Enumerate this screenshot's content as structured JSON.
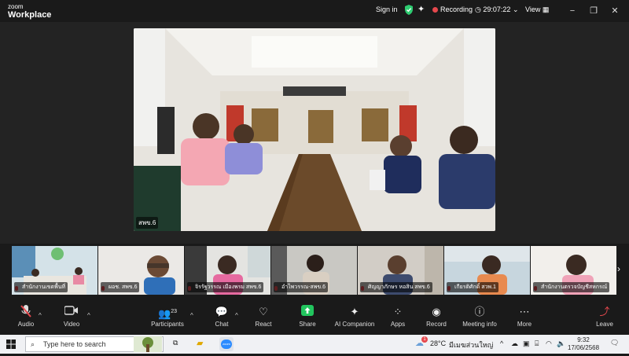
{
  "app": {
    "logo_line1": "zoom",
    "logo_line2": "Workplace"
  },
  "titlebar": {
    "sign_in": "Sign in",
    "recording_label": "Recording",
    "timer": "29:07:22",
    "view_label": "View",
    "colors": {
      "shield": "#2ecc71",
      "recording_dot": "#e5484d"
    }
  },
  "main_video": {
    "name": "สพข.6"
  },
  "participants": [
    {
      "name": "สำนักงานเขตพื้นที่"
    },
    {
      "name": "ผอช. สพข.6"
    },
    {
      "name": "จิรรัฐวรรณ เมืองพรม สพข.6"
    },
    {
      "name": "อำไพวรรณ-สพข.6"
    },
    {
      "name": "ศิญญาภักษร หอสิน สพข.6"
    },
    {
      "name": "เกียรติศักดิ์ สวพ.1"
    },
    {
      "name": "สำนักงานตรวจบัญชีสหกรณ์"
    }
  ],
  "toolbar": {
    "audio": "Audio",
    "video": "Video",
    "participants": "Participants",
    "participants_count": "23",
    "chat": "Chat",
    "react": "React",
    "share": "Share",
    "ai_companion": "AI Companion",
    "apps": "Apps",
    "record": "Record",
    "meeting_info": "Meeting info",
    "more": "More",
    "leave": "Leave",
    "colors": {
      "share": "#22c55e",
      "leave": "#e5484d",
      "mic_muted": "#e5484d"
    }
  },
  "taskbar": {
    "search_placeholder": "Type here to search",
    "weather": "28°C",
    "weather_badge": "1",
    "weather_desc": "มีเมฆส่วนใหญ่",
    "time": "9:32",
    "date": "17/06/2568"
  }
}
